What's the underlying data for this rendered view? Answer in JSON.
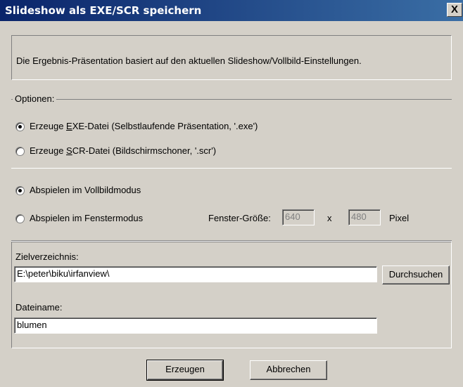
{
  "window": {
    "title": "Slideshow als EXE/SCR speichern",
    "close_label": "X"
  },
  "info_text": "Die Ergebnis-Präsentation basiert auf den aktuellen Slideshow/Vollbild-Einstellungen.",
  "options": {
    "legend": "Optionen:",
    "exe": {
      "pre": "Erzeuge ",
      "accel": "E",
      "post": "XE-Datei (Selbstlaufende Präsentation, '.exe')",
      "checked": true
    },
    "scr": {
      "pre": "Erzeuge ",
      "accel": "S",
      "post": "CR-Datei (Bildschirmschoner, '.scr')",
      "checked": false
    }
  },
  "mode": {
    "fullscreen_label": "Abspielen im Vollbildmodus",
    "window_label": "Abspielen im Fenstermodus",
    "selected": "fullscreen",
    "size_label": "Fenster-Größe:",
    "width": "640",
    "times": "x",
    "height": "480",
    "unit": "Pixel"
  },
  "target": {
    "dir_label": "Zielverzeichnis:",
    "dir_value": "E:\\peter\\biku\\irfanview\\",
    "browse_label": "Durchsuchen",
    "name_label": "Dateiname:",
    "name_value": "blumen"
  },
  "buttons": {
    "create": "Erzeugen",
    "cancel": "Abbrechen"
  }
}
